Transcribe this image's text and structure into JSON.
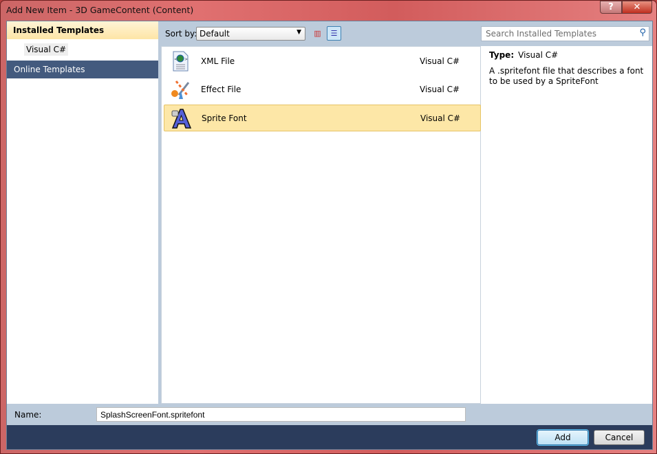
{
  "window": {
    "title": "Add New Item - 3D GameContent (Content)",
    "help": "?",
    "close": "✕"
  },
  "sidebar": {
    "installed": "Installed Templates",
    "sub": "Visual C#",
    "online": "Online Templates"
  },
  "toolbar": {
    "sort_label": "Sort by:",
    "sort_value": "Default",
    "search_placeholder": "Search Installed Templates"
  },
  "templates": [
    {
      "name": "XML File",
      "type": "Visual C#",
      "icon": "xml-file-icon"
    },
    {
      "name": "Effect File",
      "type": "Visual C#",
      "icon": "effect-file-icon"
    },
    {
      "name": "Sprite Font",
      "type": "Visual C#",
      "icon": "sprite-font-icon",
      "selected": true
    }
  ],
  "details": {
    "type_label": "Type:",
    "type_value": "Visual C#",
    "description": "A .spritefont file that describes a font to be used by a SpriteFont"
  },
  "name_field": {
    "label": "Name:",
    "value": "SplashScreenFont.spritefont"
  },
  "buttons": {
    "add": "Add",
    "cancel": "Cancel"
  }
}
